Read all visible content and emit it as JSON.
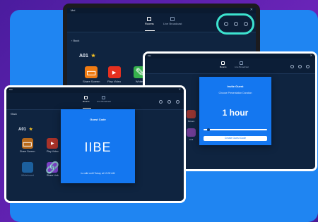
{
  "laptop": {
    "title": "Mei",
    "tabs": [
      {
        "label": "Rooms",
        "active": true
      },
      {
        "label": "Live Broadcast",
        "active": false
      }
    ],
    "back_label": "Back",
    "room_name": "A01",
    "star": "★",
    "tiles": [
      {
        "label": "Share Screen",
        "color": "#f07b12"
      },
      {
        "label": "Play Video",
        "color": "#e5301f"
      },
      {
        "label": "Whiteb",
        "color": "#37b14d"
      }
    ]
  },
  "right_window": {
    "title": "Mei",
    "tabs": [
      {
        "label": "Rooms",
        "active": true
      },
      {
        "label": "Live Broadcast",
        "active": false
      }
    ],
    "dialog": {
      "title": "Invite Guest",
      "subtitle": "Choose Presentation Duration",
      "duration": "1 hour",
      "slider_level": 0.05,
      "button_label": "Create Guest Code"
    },
    "background_tiles": [
      {
        "label": "Screen",
        "color": "#c0392b"
      },
      {
        "label": "Link",
        "color": "#8e44ad"
      }
    ]
  },
  "left_window": {
    "title": "Mei",
    "tabs": [
      {
        "label": "Rooms",
        "active": true
      },
      {
        "label": "Live Broadcast",
        "active": false
      }
    ],
    "back_label": "Back",
    "room_name": "A01",
    "star": "★",
    "tiles": [
      {
        "label": "Share Screen",
        "color": "#b86a1c"
      },
      {
        "label": "Play Video",
        "color": "#a83229"
      },
      {
        "label": "Whiteboard",
        "color": "#1f6fb5"
      },
      {
        "label": "Share Link",
        "color": "#7a3fc4"
      }
    ],
    "dialog": {
      "title": "Guest Code",
      "code": "IIBE",
      "validity": "is valid until Today at 10:02 AM"
    }
  },
  "colors": {
    "highlight": "#3de3cf",
    "dialog": "#1477f0",
    "panel": "#1f85f2",
    "background": "#5a1fa8"
  },
  "icons": [
    "rooms-icon",
    "broadcast-icon",
    "pen-icon",
    "user-icon",
    "settings-icon",
    "back-chevron-icon",
    "star-icon"
  ]
}
